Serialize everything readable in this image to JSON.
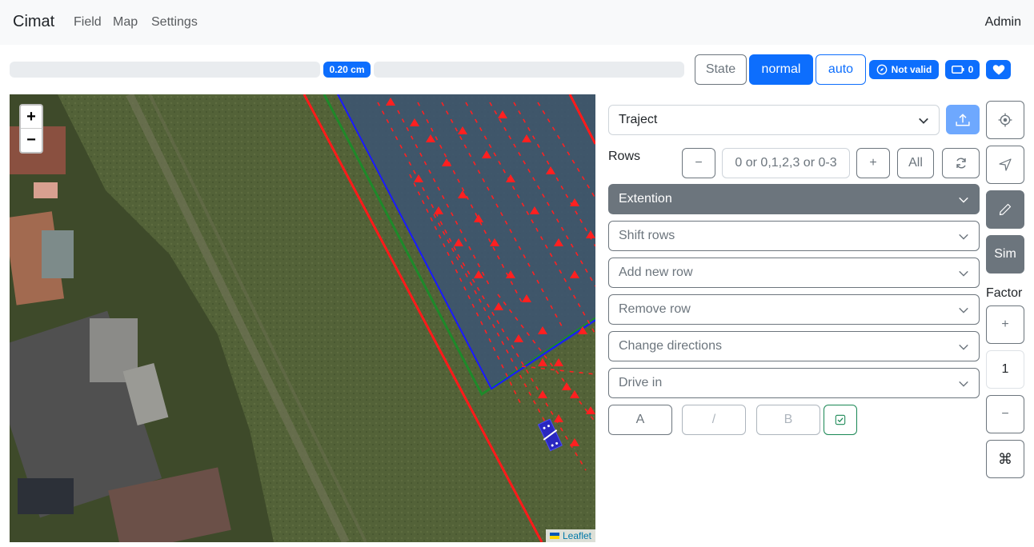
{
  "navbar": {
    "brand": "Cimat",
    "links": [
      "Field",
      "Map",
      "Settings"
    ],
    "user": "Admin"
  },
  "status": {
    "accuracy": "0.20 cm",
    "state_label": "State",
    "mode_normal": "normal",
    "mode_auto": "auto",
    "validity": "Not valid",
    "battery_count": "0"
  },
  "map": {
    "zoom_in": "+",
    "zoom_out": "−",
    "attribution": "Leaflet"
  },
  "panel": {
    "traject_select": "Traject",
    "rows_label": "Rows",
    "rows_minus": "−",
    "rows_placeholder": "0 or 0,1,2,3 or 0-3",
    "rows_plus": "+",
    "rows_all": "All",
    "sections": [
      {
        "label": "Extention",
        "active": true
      },
      {
        "label": "Shift rows",
        "active": false
      },
      {
        "label": "Add new row",
        "active": false
      },
      {
        "label": "Remove row",
        "active": false
      },
      {
        "label": "Change directions",
        "active": false
      },
      {
        "label": "Drive in",
        "active": false
      }
    ],
    "point_a": "A",
    "point_sep": "/",
    "point_b": "B"
  },
  "sidebar": {
    "sim_label": "Sim",
    "factor_label": "Factor",
    "factor_plus": "+",
    "factor_value": "1",
    "factor_minus": "−",
    "command_symbol": "⌘"
  },
  "colors": {
    "primary": "#0d6efd",
    "secondary": "#6c757d",
    "success": "#198754",
    "boundary_red": "#ff1a1a",
    "boundary_green": "#1e8a2a",
    "boundary_blue": "#1a1aff"
  }
}
